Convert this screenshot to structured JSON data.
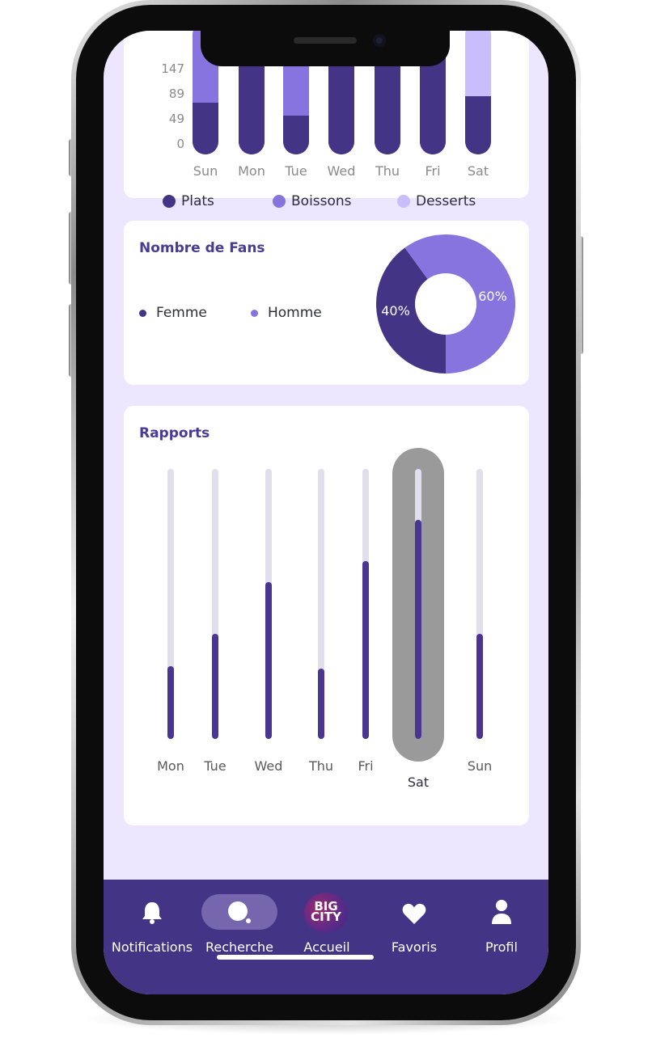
{
  "meals_chart": {
    "y_ticks": [
      "147",
      "89",
      "49",
      "0"
    ],
    "days": [
      "Sun",
      "Mon",
      "Tue",
      "Wed",
      "Thu",
      "Fri",
      "Sat"
    ],
    "legend": [
      {
        "label": "Plats",
        "color": "#433486"
      },
      {
        "label": "Boissons",
        "color": "#8774de"
      },
      {
        "label": "Desserts",
        "color": "#c9bdfb"
      }
    ]
  },
  "fans": {
    "title": "Nombre de Fans",
    "legend": [
      {
        "label": "Femme",
        "color": "#433486"
      },
      {
        "label": "Homme",
        "color": "#8774de"
      }
    ],
    "chart_data": {
      "type": "pie",
      "categories": [
        "Femme",
        "Homme"
      ],
      "values": [
        40,
        60
      ],
      "labels": [
        "40%",
        "60%"
      ]
    }
  },
  "rapports": {
    "title": "Rapports",
    "selected_day": "Sat",
    "chart_data": {
      "type": "bar",
      "categories": [
        "Mon",
        "Tue",
        "Wed",
        "Thu",
        "Fri",
        "Sat",
        "Sun"
      ],
      "values": [
        27,
        39,
        58,
        26,
        66,
        81,
        39
      ],
      "ylim": [
        0,
        100
      ]
    }
  },
  "nav": {
    "items": [
      {
        "label": "Notifications",
        "icon": "bell-icon"
      },
      {
        "label": "Recherche",
        "icon": "search-icon"
      },
      {
        "label": "Accueil",
        "icon": "big-city-logo"
      },
      {
        "label": "Favoris",
        "icon": "heart-icon"
      },
      {
        "label": "Profil",
        "icon": "user-icon"
      }
    ],
    "logo_text_line1": "BIG",
    "logo_text_line2": "CITY"
  }
}
